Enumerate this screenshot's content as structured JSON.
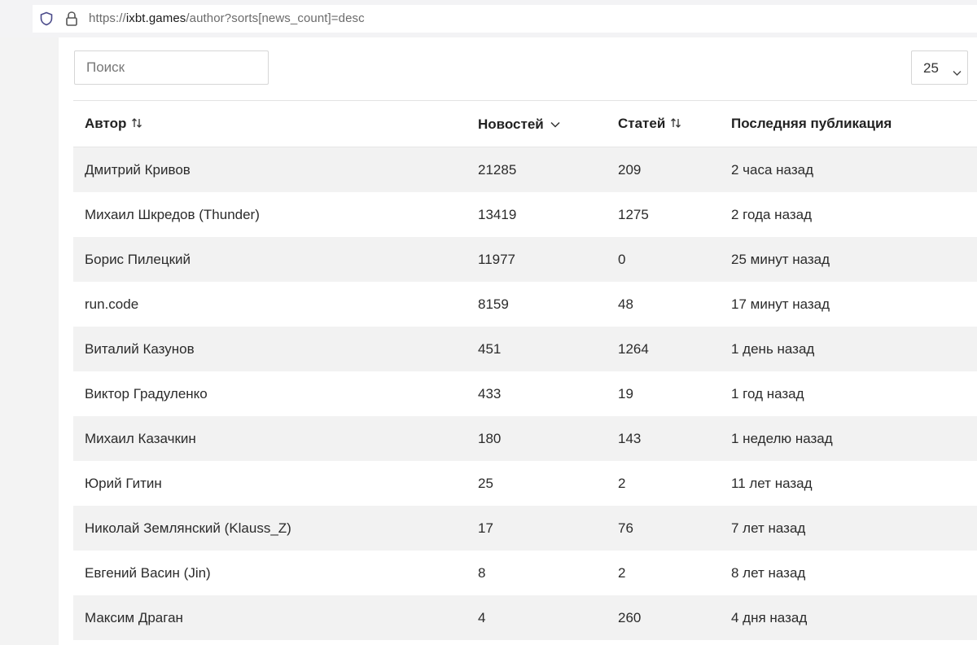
{
  "browser": {
    "url_prefix": "https://",
    "url_host": "ixbt.games",
    "url_path": "/author?sorts[news_count]=desc"
  },
  "controls": {
    "search_placeholder": "Поиск",
    "per_page_value": "25"
  },
  "table": {
    "columns": [
      {
        "label": "Автор",
        "sort": "none"
      },
      {
        "label": "Новостей",
        "sort": "desc"
      },
      {
        "label": "Статей",
        "sort": "none"
      },
      {
        "label": "Последняя публикация",
        "sort": ""
      }
    ],
    "rows": [
      {
        "author": "Дмитрий Кривов",
        "news": "21285",
        "articles": "209",
        "last": "2 часа назад"
      },
      {
        "author": "Михаил Шкредов (Thunder)",
        "news": "13419",
        "articles": "1275",
        "last": "2 года назад"
      },
      {
        "author": "Борис Пилецкий",
        "news": "11977",
        "articles": "0",
        "last": "25 минут назад"
      },
      {
        "author": "run.code",
        "news": "8159",
        "articles": "48",
        "last": "17 минут назад"
      },
      {
        "author": "Виталий Казунов",
        "news": "451",
        "articles": "1264",
        "last": "1 день назад"
      },
      {
        "author": "Виктор Градуленко",
        "news": "433",
        "articles": "19",
        "last": "1 год назад"
      },
      {
        "author": "Михаил Казачкин",
        "news": "180",
        "articles": "143",
        "last": "1 неделю назад"
      },
      {
        "author": "Юрий Гитин",
        "news": "25",
        "articles": "2",
        "last": "11 лет назад"
      },
      {
        "author": "Николай Землянский (Klauss_Z)",
        "news": "17",
        "articles": "76",
        "last": "7 лет назад"
      },
      {
        "author": "Евгений Васин (Jin)",
        "news": "8",
        "articles": "2",
        "last": "8 лет назад"
      },
      {
        "author": "Максим Драган",
        "news": "4",
        "articles": "260",
        "last": "4 дня назад"
      }
    ]
  }
}
